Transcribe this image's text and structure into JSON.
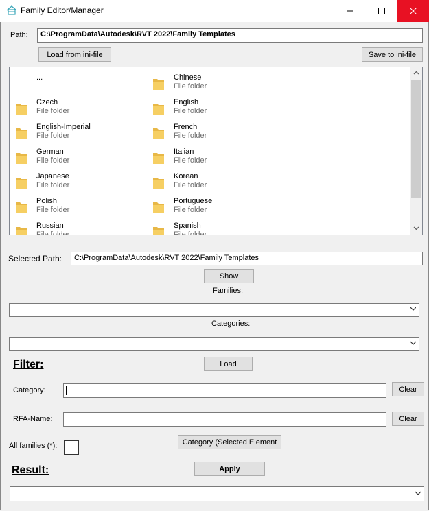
{
  "window": {
    "title": "Family Editor/Manager"
  },
  "path": {
    "label": "Path:",
    "value": "C:\\ProgramData\\Autodesk\\RVT 2022\\Family Templates",
    "load_button": "Load from ini-file",
    "save_button": "Save to ini-file"
  },
  "list": {
    "items": [
      {
        "name": "...",
        "type": ""
      },
      {
        "name": "Chinese",
        "type": "File folder"
      },
      {
        "name": "Czech",
        "type": "File folder"
      },
      {
        "name": "English",
        "type": "File folder"
      },
      {
        "name": "English-Imperial",
        "type": "File folder"
      },
      {
        "name": "French",
        "type": "File folder"
      },
      {
        "name": "German",
        "type": "File folder"
      },
      {
        "name": "Italian",
        "type": "File folder"
      },
      {
        "name": "Japanese",
        "type": "File folder"
      },
      {
        "name": "Korean",
        "type": "File folder"
      },
      {
        "name": "Polish",
        "type": "File folder"
      },
      {
        "name": "Portuguese",
        "type": "File folder"
      },
      {
        "name": "Russian",
        "type": "File folder"
      },
      {
        "name": "Spanish",
        "type": "File folder"
      }
    ]
  },
  "selected": {
    "label": "Selected Path:",
    "value": "C:\\ProgramData\\Autodesk\\RVT 2022\\Family Templates",
    "show_button": "Show"
  },
  "families": {
    "label": "Families:",
    "value": ""
  },
  "categories": {
    "label": "Categories:",
    "value": "",
    "load_button": "Load"
  },
  "filter": {
    "heading": "Filter:",
    "category_label": "Category:",
    "category_value": "",
    "clear_label": "Clear",
    "rfa_label": "RFA-Name:",
    "rfa_value": "",
    "clear2_label": "Clear",
    "all_families_label": "All families (*):",
    "category_selected_button": "Category (Selected Element"
  },
  "result": {
    "heading": "Result:",
    "apply_button": "Apply",
    "value": ""
  },
  "colors": {
    "close": "#e81123",
    "folder": "#f6cf63",
    "folder_dark": "#e8b847"
  }
}
